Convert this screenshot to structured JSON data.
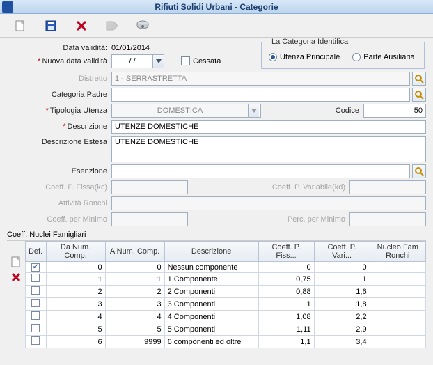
{
  "title": "Rifiuti Solidi Urbani - Categorie",
  "labels": {
    "dataValidita": "Data validità:",
    "nuovaData": "Nuova data validità",
    "cessata": "Cessata",
    "groupTitle": "La Categoria Identifica",
    "utenzaPrincipale": "Utenza Principale",
    "parteAusiliaria": "Parte Ausiliaria",
    "distretto": "Distretto",
    "categoriaPadre": "Categoria Padre",
    "tipologiaUtenza": "Tipologia Utenza",
    "codice": "Codice",
    "descrizione": "Descrizione",
    "descrizioneEstesa": "Descrizione Estesa",
    "esenzione": "Esenzione",
    "coeffFissa": "Coeff. P. Fissa(kc)",
    "coeffVariabile": "Coeff. P. Variabile(kd)",
    "attivitaRonchi": "Attività Ronchi",
    "coeffMinimo": "Coeff. per Minimo",
    "percMinimo": "Perc. per Minimo",
    "section": "Coeff. Nuclei Famigliari"
  },
  "values": {
    "dataValidita": "01/01/2014",
    "nuovaData": "/ /",
    "distretto": "1 - SERRASTRETTA",
    "tipologiaUtenza": "DOMESTICA",
    "codice": "50",
    "descrizione": "UTENZE DOMESTICHE",
    "descrizioneEstesa": "UTENZE DOMESTICHE",
    "utenzaPrincipaleSelected": true
  },
  "table": {
    "headers": {
      "def": "Def.",
      "daNum": "Da Num. Comp.",
      "aNum": "A Num. Comp.",
      "descr": "Descrizione",
      "cFiss": "Coeff. P. Fiss...",
      "cVar": "Coeff. P. Vari...",
      "ronchi": "Nucleo Fam Ronchi"
    },
    "rows": [
      {
        "def": true,
        "da": "0",
        "a": "0",
        "descr": "Nessun componente",
        "fiss": "0",
        "var": "0",
        "ronchi": ""
      },
      {
        "def": false,
        "da": "1",
        "a": "1",
        "descr": "1 Componente",
        "fiss": "0,75",
        "var": "1",
        "ronchi": ""
      },
      {
        "def": false,
        "da": "2",
        "a": "2",
        "descr": "2 Componenti",
        "fiss": "0,88",
        "var": "1,6",
        "ronchi": ""
      },
      {
        "def": false,
        "da": "3",
        "a": "3",
        "descr": "3 Componenti",
        "fiss": "1",
        "var": "1,8",
        "ronchi": ""
      },
      {
        "def": false,
        "da": "4",
        "a": "4",
        "descr": "4 Componenti",
        "fiss": "1,08",
        "var": "2,2",
        "ronchi": ""
      },
      {
        "def": false,
        "da": "5",
        "a": "5",
        "descr": "5 Componenti",
        "fiss": "1,11",
        "var": "2,9",
        "ronchi": ""
      },
      {
        "def": false,
        "da": "6",
        "a": "9999",
        "descr": "6 componenti ed oltre",
        "fiss": "1,1",
        "var": "3,4",
        "ronchi": ""
      }
    ]
  }
}
